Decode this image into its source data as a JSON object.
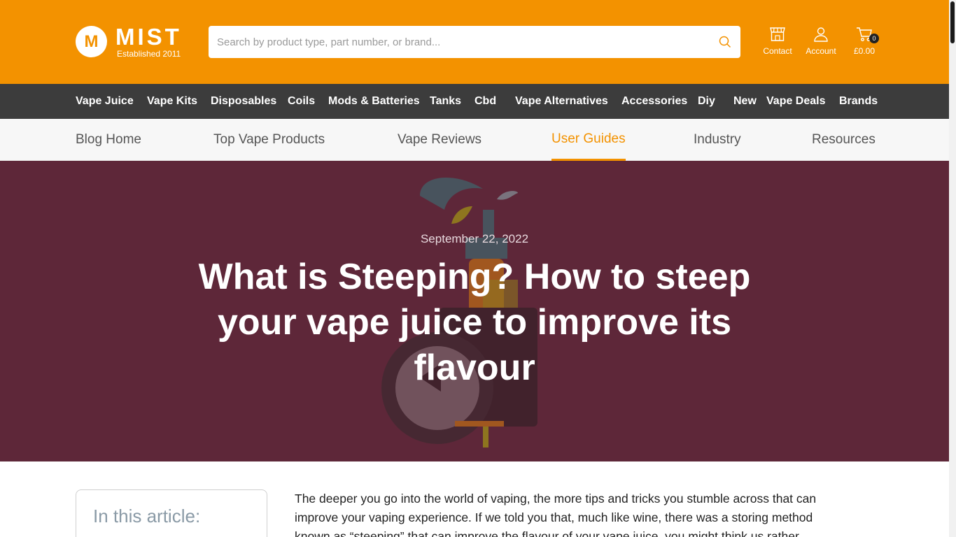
{
  "brand": {
    "name": "MIST",
    "tagline": "Established 2011",
    "logo_letter": "M",
    "accent_color": "#f39200"
  },
  "search": {
    "placeholder": "Search by product type, part number, or brand..."
  },
  "header_actions": {
    "contact": "Contact",
    "account": "Account",
    "cart_total": "£0.00",
    "cart_count": "0"
  },
  "main_nav": [
    "Vape Juice",
    "Vape Kits",
    "Disposables",
    "Coils",
    "Mods & Batteries",
    "Tanks",
    "Cbd",
    "Vape Alternatives",
    "Accessories",
    "Diy",
    "New",
    "Vape Deals",
    "Brands"
  ],
  "blog_nav": [
    {
      "label": "Blog Home",
      "active": false
    },
    {
      "label": "Top Vape Products",
      "active": false
    },
    {
      "label": "Vape Reviews",
      "active": false
    },
    {
      "label": "User Guides",
      "active": true
    },
    {
      "label": "Industry",
      "active": false
    },
    {
      "label": "Resources",
      "active": false
    }
  ],
  "hero": {
    "date": "September 22, 2022",
    "title": "What is Steeping? How to steep your vape juice to improve its flavour",
    "background_color": "#5e2739"
  },
  "toc": {
    "title": "In this article:"
  },
  "article": {
    "intro": "The deeper you go into the world of vaping, the more tips and tricks you stumble across that can improve your vaping experience. If we told you that, much like wine, there was a storing method known as “steeping” that can improve the flavour of your vape juice, you might think us rather"
  }
}
